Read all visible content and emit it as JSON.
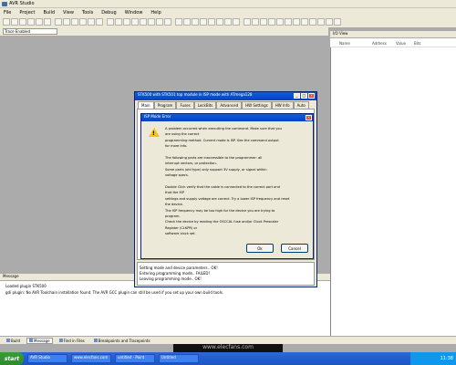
{
  "window": {
    "title": "AVR Studio"
  },
  "menu": [
    "File",
    "Project",
    "Build",
    "View",
    "Tools",
    "Debug",
    "Window",
    "Help"
  ],
  "toolbar": {
    "platform_combo": "Trace Enabled"
  },
  "right_panel": {
    "title": "I/O View",
    "columns": [
      "Name",
      "Address",
      "Value",
      "Bits"
    ]
  },
  "message_panel": {
    "title": "Message",
    "lines": [
      "Loaded plugin STK500",
      "gdi plugin: No AVR Toolchain installation found. The AVR GCC plugin can still be used if you set up your own build tools."
    ]
  },
  "bottom_tabs": [
    {
      "label": "Build",
      "active": false
    },
    {
      "label": "Message",
      "active": true
    },
    {
      "label": "Find in Files",
      "active": false
    },
    {
      "label": "Breakpoints and Tracepoints",
      "active": false
    }
  ],
  "taskbar": {
    "start": "start",
    "buttons": [
      "AVR Studio",
      "www.elecfans.com",
      "untitled - Paint",
      "Untitled"
    ],
    "clock": "11:38",
    "watermark": "www.elecfans.com"
  },
  "outer_dialog": {
    "title": "STK500 with STK501 top module in ISP mode with ATmega128",
    "tabs": [
      "Main",
      "Program",
      "Fuses",
      "LockBits",
      "Advanced",
      "HW Settings",
      "HW Info",
      "Auto"
    ],
    "status_lines": [
      "Setting mode and device parameters.. OK!",
      "Entering programming mode.. FAILED!",
      "Leaving programming mode.. OK!"
    ]
  },
  "message_box": {
    "title": "ISP Mode Error",
    "lines": [
      "A problem occurred when executing the command. Make sure that you",
      "are using the correct",
      "programming method. Current mode is ISP. See the command output",
      "for more info.",
      "",
      "The following parts are inaccessible to the programmer: all",
      "interrupt vectors, or protection.",
      "Some parts (old type) only support 3V supply, or signal within",
      "voltage specs.",
      "",
      "Double Click verify that the cable is connected to the correct port and",
      "that the ISP",
      "settings and supply voltage are correct. Try a lower ISP frequency and reset",
      "the device.",
      "The ISP frequency may be too high for the device you are trying to",
      "program.",
      "Check the device by reading the OSCCAL fuse and/or Clock Prescaler",
      "Register (CLKPR) or",
      "software clock set."
    ],
    "buttons": [
      "Ok",
      "Cancel"
    ]
  }
}
